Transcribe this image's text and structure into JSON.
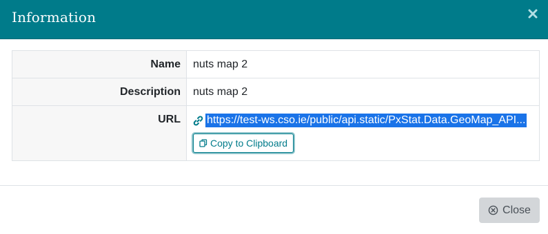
{
  "modal": {
    "title": "Information"
  },
  "info": {
    "rows": [
      {
        "label": "Name",
        "value": "nuts map 2"
      },
      {
        "label": "Description",
        "value": "nuts map 2"
      },
      {
        "label": "URL",
        "value": "https://test-ws.cso.ie/public/api.static/PxStat.Data.GeoMap_API..."
      }
    ],
    "copy_button_label": "Copy to Clipboard"
  },
  "footer": {
    "close_label": "Close"
  },
  "icons": {
    "header_close": "close-icon",
    "url": "link-icon",
    "copy": "copy-icon",
    "close_button": "circle-x-icon"
  },
  "colors": {
    "header": "#007b8a",
    "url_highlight": "#1a73e8",
    "close_button": "#d3d6d9"
  }
}
